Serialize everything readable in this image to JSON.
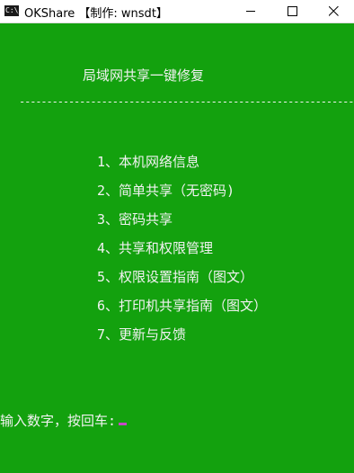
{
  "window": {
    "title": "OKShare  【制作: wnsdt】",
    "icon": "cmd-icon",
    "icon_text": "C:\\_"
  },
  "colors": {
    "background": "#13a10e",
    "text": "#f2f2f2",
    "cursor": "#c64ac6"
  },
  "console": {
    "header": "局域网共享一键修复",
    "separator": "--------------------------------------------------------------",
    "menu": [
      "1、本机网络信息",
      "2、简单共享（无密码)",
      "3、密码共享",
      "4、共享和权限管理",
      "5、权限设置指南（图文）",
      "6、打印机共享指南（图文）",
      "7、更新与反馈"
    ],
    "prompt": "输入数字，按回车:"
  }
}
